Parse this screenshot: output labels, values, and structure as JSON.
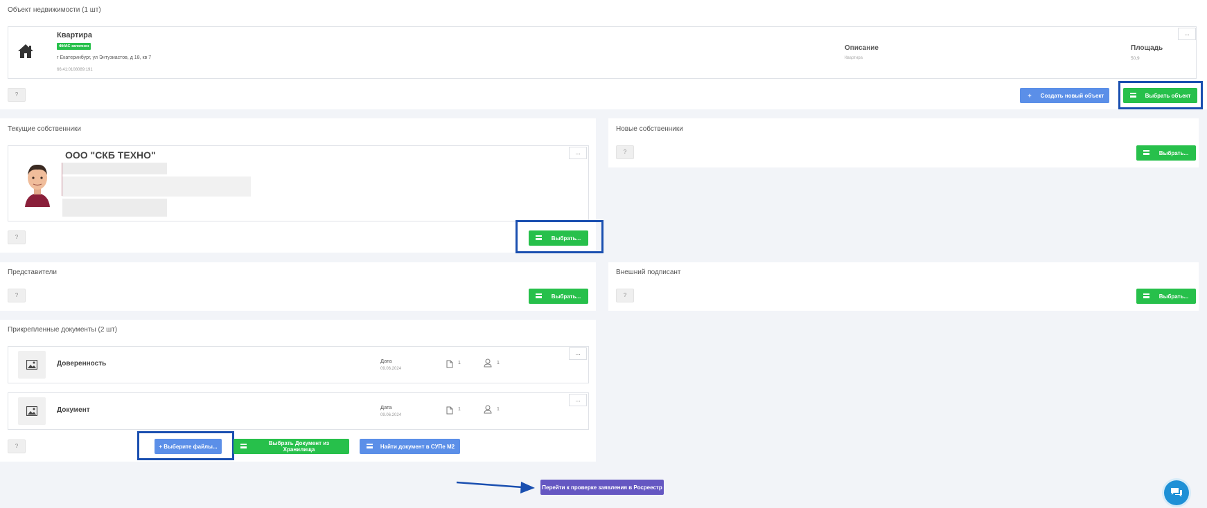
{
  "object_section": {
    "title": "Объект недвижимости (1 шт)",
    "item": {
      "name": "Квартира",
      "badge": "ФИАС заполнен",
      "address": "г Екатеринбург, ул Энтузиастов, д 18, кв 7",
      "cadastral": "66:41:0108089:191",
      "desc_label": "Описание",
      "desc_value": "Квартира",
      "area_label": "Площадь",
      "area_value": "50,9"
    },
    "help": "?",
    "more": "...",
    "create_btn": "Создать новый объект",
    "select_btn": "Выбрать объект"
  },
  "current_owners": {
    "title": "Текущие собственники",
    "owner_name": "ООО \"СКБ ТЕХНО\"",
    "help": "?",
    "more": "...",
    "select_btn": "Выбрать..."
  },
  "new_owners": {
    "title": "Новые собственники",
    "help": "?",
    "select_btn": "Выбрать..."
  },
  "representatives": {
    "title": "Представители",
    "help": "?",
    "select_btn": "Выбрать..."
  },
  "external_signer": {
    "title": "Внешний подписант",
    "help": "?",
    "select_btn": "Выбрать..."
  },
  "documents": {
    "title": "Прикрепленные документы (2 шт)",
    "date_label": "Дата",
    "items": [
      {
        "name": "Доверенность",
        "date": "09.06.2024",
        "files": "1",
        "signers": "1",
        "more": "..."
      },
      {
        "name": "Документ",
        "date": "09.06.2024",
        "files": "1",
        "signers": "1",
        "more": "..."
      }
    ],
    "help": "?",
    "choose_files_btn": "+ Выберите файлы...",
    "from_storage_btn": "Выбрать Документ из Хранилища",
    "find_supe_btn": "Найти документ в СУПе М2"
  },
  "footer": {
    "proceed_btn": "Перейти к проверке заявления в Росреестр"
  },
  "colors": {
    "green": "#27c04b",
    "blue": "#5b8fe8",
    "purple": "#6557c2",
    "highlight": "#1a4fb0",
    "chat": "#1e90d6"
  },
  "icons": [
    "home-icon",
    "list-icon",
    "plus-icon",
    "image-icon",
    "file-icon",
    "user-icon",
    "chat-icon",
    "arrow-icon",
    "avatar"
  ]
}
